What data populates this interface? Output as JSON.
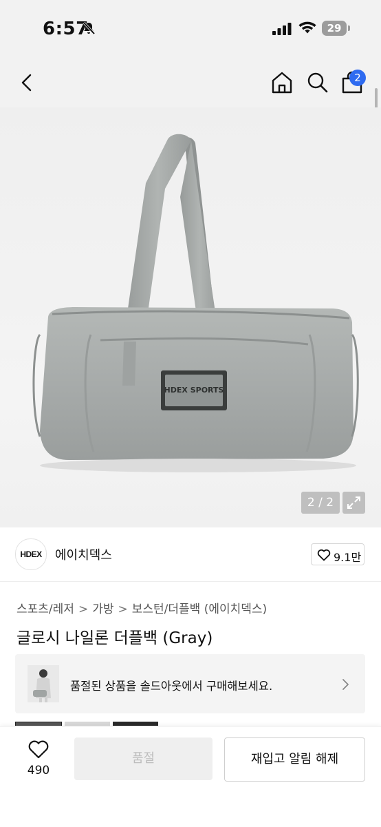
{
  "status_bar": {
    "time": "6:57",
    "battery": "29"
  },
  "nav": {
    "cart_count": "2"
  },
  "gallery": {
    "counter": "2 / 2",
    "patch_text": "HDEX SPORTS"
  },
  "brand": {
    "logo_text": "HDEX",
    "name": "에이치덱스",
    "likes": "9.1만"
  },
  "breadcrumb": [
    "스포츠/레저",
    "가방",
    "보스턴/더플백 (에이치덱스)"
  ],
  "product": {
    "title": "글로시 나일론 더플백 (Gray)"
  },
  "banner": {
    "text": "품절된 상품을 솔드아웃에서 구매해보세요."
  },
  "bottom_bar": {
    "wish_count": "490",
    "soldout_label": "품절",
    "restock_label": "재입고 알림 해제"
  },
  "colors": {
    "accent_badge": "#2f6bf0",
    "bag_gray": "#a9adab"
  }
}
